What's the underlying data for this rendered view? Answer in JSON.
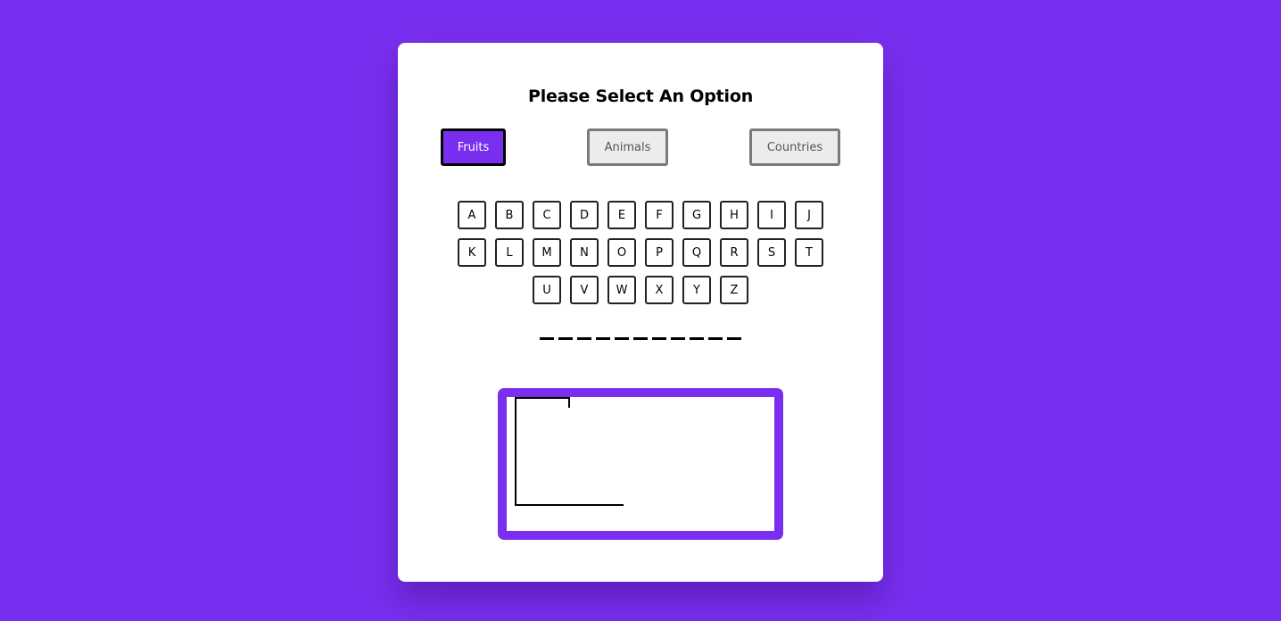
{
  "title": "Please Select An Option",
  "options": [
    {
      "label": "Fruits",
      "active": true
    },
    {
      "label": "Animals",
      "active": false
    },
    {
      "label": "Countries",
      "active": false
    }
  ],
  "letters": [
    "A",
    "B",
    "C",
    "D",
    "E",
    "F",
    "G",
    "H",
    "I",
    "J",
    "K",
    "L",
    "M",
    "N",
    "O",
    "P",
    "Q",
    "R",
    "S",
    "T",
    "U",
    "V",
    "W",
    "X",
    "Y",
    "Z"
  ],
  "word_blanks": 11,
  "colors": {
    "background": "#7a2ff0",
    "accent": "#7a2ff0",
    "card": "#ffffff"
  }
}
